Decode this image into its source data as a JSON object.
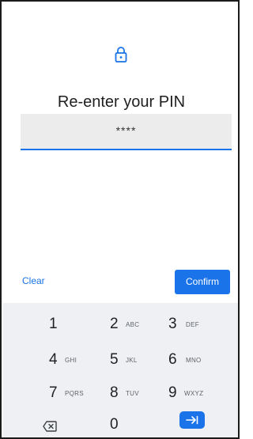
{
  "header": {
    "title": "Re-enter your PIN"
  },
  "pin_field": {
    "value": "****"
  },
  "actions": {
    "clear_label": "Clear",
    "confirm_label": "Confirm"
  },
  "keypad": {
    "keys": [
      {
        "digit": "1",
        "letters": ""
      },
      {
        "digit": "2",
        "letters": "ABC"
      },
      {
        "digit": "3",
        "letters": "DEF"
      },
      {
        "digit": "4",
        "letters": "GHI"
      },
      {
        "digit": "5",
        "letters": "JKL"
      },
      {
        "digit": "6",
        "letters": "MNO"
      },
      {
        "digit": "7",
        "letters": "PQRS"
      },
      {
        "digit": "8",
        "letters": "TUV"
      },
      {
        "digit": "9",
        "letters": "WXYZ"
      },
      {
        "digit": "0",
        "letters": ""
      }
    ],
    "backspace_icon": "backspace-icon",
    "enter_icon": "enter-arrow-icon"
  },
  "colors": {
    "accent": "#1a73e8",
    "keypad_bg": "#eef0f3",
    "field_bg": "#ececec"
  }
}
